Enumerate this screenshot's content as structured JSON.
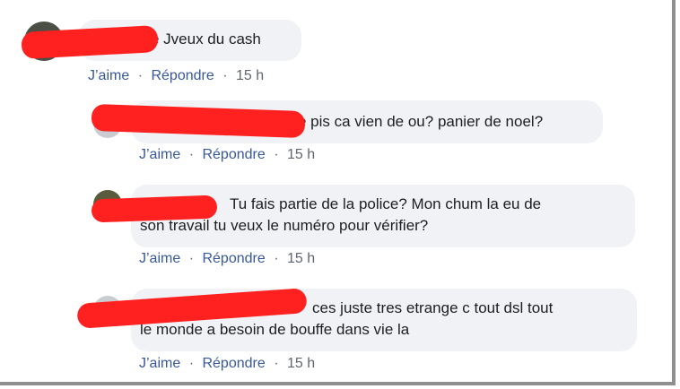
{
  "comments": [
    {
      "text": "e Jveux du cash",
      "like_label": "J’aime",
      "reply_label": "Répondre",
      "sep1": "·",
      "sep2": "·",
      "time": "15 h"
    },
    {
      "text": "e pis ca vien de ou? panier de noel?",
      "like_label": "J’aime",
      "reply_label": "Répondre",
      "sep1": "·",
      "sep2": "·",
      "time": "15 h"
    },
    {
      "text_line1": "Tu fais partie de la police? Mon chum la eu de",
      "text_line2": "son travail tu veux le numéro pour vérifier?",
      "like_label": "J’aime",
      "reply_label": "Répondre",
      "sep1": "·",
      "sep2": "·",
      "time": "15 h"
    },
    {
      "text_line1": "ces juste tres etrange c tout dsl tout",
      "text_line2": "le monde a besoin de bouffe dans vie la",
      "like_label": "J’aime",
      "reply_label": "Répondre",
      "sep1": "·",
      "sep2": "·",
      "time": "15 h"
    }
  ],
  "colors": {
    "bubble": "#f0f2f5",
    "link": "#385898",
    "meta": "#606770",
    "redaction": "#ff2020"
  }
}
